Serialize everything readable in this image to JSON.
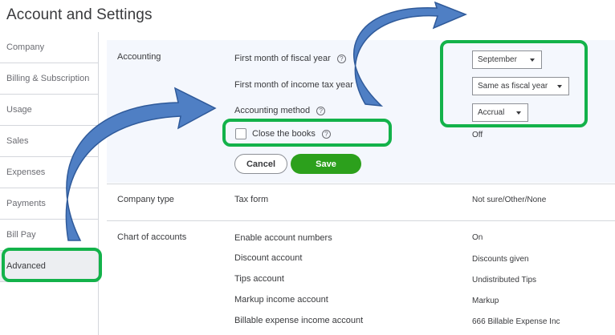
{
  "page_title": "Account and Settings",
  "sidebar": {
    "items": [
      {
        "label": "Company"
      },
      {
        "label": "Billing & Subscription"
      },
      {
        "label": "Usage"
      },
      {
        "label": "Sales"
      },
      {
        "label": "Expenses"
      },
      {
        "label": "Payments"
      },
      {
        "label": "Bill Pay"
      },
      {
        "label": "Advanced",
        "active": true
      }
    ]
  },
  "accounting": {
    "title": "Accounting",
    "fiscal_year_label": "First month of fiscal year",
    "fiscal_year_value": "September",
    "income_tax_label": "First month of income tax year",
    "income_tax_value": "Same as fiscal year",
    "method_label": "Accounting method",
    "method_value": "Accrual",
    "close_books_label": "Close the books",
    "close_books_checked": false,
    "close_books_value": "Off",
    "help_glyph": "?",
    "cancel_label": "Cancel",
    "save_label": "Save"
  },
  "company_type": {
    "title": "Company type",
    "tax_form_label": "Tax form",
    "tax_form_value": "Not sure/Other/None"
  },
  "chart_of_accounts": {
    "title": "Chart of accounts",
    "rows": [
      {
        "label": "Enable account numbers",
        "value": "On"
      },
      {
        "label": "Discount account",
        "value": "Discounts given"
      },
      {
        "label": "Tips account",
        "value": "Undistributed Tips"
      },
      {
        "label": "Markup income account",
        "value": "Markup"
      },
      {
        "label": "Billable expense income account",
        "value": "666 Billable Expense Inc"
      }
    ]
  },
  "colors": {
    "highlight": "#13b24a",
    "arrow_fill": "#4f7fc4",
    "save_button": "#2ca01c",
    "section_bg": "#f4f7fd"
  }
}
